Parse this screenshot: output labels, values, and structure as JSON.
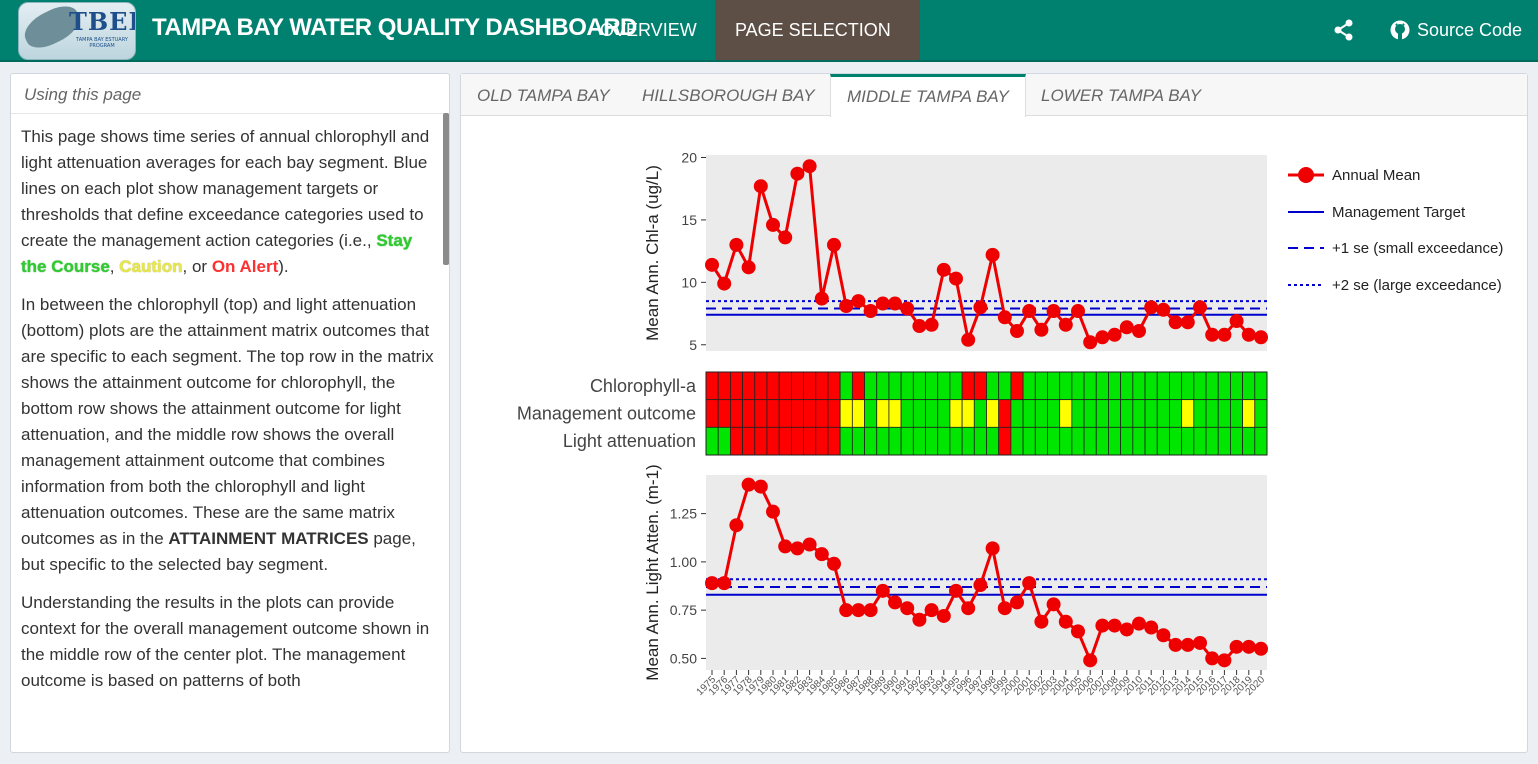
{
  "header": {
    "logo_text": "TBEP",
    "logo_subtext": "TAMPA BAY ESTUARY PROGRAM",
    "title": "TAMPA BAY WATER QUALITY DASHBOARD",
    "nav": {
      "overview": "OVERVIEW",
      "page_selection": "PAGE SELECTION"
    },
    "source_code": "Source Code",
    "accent": "#00806e"
  },
  "sidebar": {
    "heading": "Using this page",
    "p1_before": "This page shows time series of annual chlorophyll and light attenuation averages for each bay segment. Blue lines on each plot show management targets or thresholds that define exceedance categories used to create the management action categories (i.e., ",
    "stay": "Stay the Course",
    "sep1": ", ",
    "caution": "Caution",
    "sep2": ", or ",
    "alert": "On Alert",
    "p1_after": ").",
    "p2_before": "In between the chlorophyll (top) and light attenuation (bottom) plots are the attainment matrix outcomes that are specific to each segment. The top row in the matrix shows the attainment outcome for chlorophyll, the bottom row shows the attainment outcome for light attenuation, and the middle row shows the overall management attainment outcome that combines information from both the chlorophyll and light attenuation outcomes. These are the same matrix outcomes as in the ",
    "p2_bold": "ATTAINMENT MATRICES",
    "p2_after": " page, but specific to the selected bay segment.",
    "p3": "Understanding the results in the plots can provide context for the overall management outcome shown in the middle row of the center plot. The management outcome is based on patterns of both"
  },
  "tabs": [
    "OLD TAMPA BAY",
    "HILLSBOROUGH BAY",
    "MIDDLE TAMPA BAY",
    "LOWER TAMPA BAY"
  ],
  "chart_data": [
    {
      "type": "line",
      "ylabel": "Mean Ann. Chl-a (ug/L)",
      "ylim": [
        4.5,
        20.2
      ],
      "yticks": [
        5,
        10,
        15,
        20
      ],
      "x": [
        1975,
        1976,
        1977,
        1978,
        1979,
        1980,
        1981,
        1982,
        1983,
        1984,
        1985,
        1986,
        1987,
        1988,
        1989,
        1990,
        1991,
        1992,
        1993,
        1994,
        1995,
        1996,
        1997,
        1998,
        1999,
        2000,
        2001,
        2002,
        2003,
        2004,
        2005,
        2006,
        2007,
        2008,
        2009,
        2010,
        2011,
        2012,
        2013,
        2014,
        2015,
        2016,
        2017,
        2018,
        2019,
        2020
      ],
      "series": [
        {
          "name": "Annual Mean",
          "values": [
            11.4,
            9.9,
            13.0,
            11.2,
            17.7,
            14.6,
            13.6,
            18.7,
            19.3,
            8.7,
            13.0,
            8.1,
            8.5,
            7.7,
            8.3,
            8.3,
            7.9,
            6.5,
            6.6,
            11.0,
            10.3,
            5.4,
            8.0,
            12.2,
            7.2,
            6.1,
            7.7,
            6.2,
            7.7,
            6.6,
            7.7,
            5.2,
            5.6,
            5.8,
            6.4,
            6.1,
            8.0,
            7.8,
            6.8,
            6.8,
            8.0,
            5.8,
            5.8,
            6.9,
            5.8,
            5.6
          ]
        },
        {
          "name": "Management Target",
          "values": [
            7.4
          ]
        },
        {
          "name": "+1 se (small exceedance)",
          "values": [
            7.9
          ]
        },
        {
          "name": "+2 se (large exceedance)",
          "values": [
            8.5
          ]
        }
      ],
      "legend_position": "right",
      "grid": false
    },
    {
      "type": "heatmap",
      "rows": [
        "Chlorophyll-a",
        "Management outcome",
        "Light attenuation"
      ],
      "colors": {
        "red": "#ff0000",
        "yellow": "#ffff00",
        "green": "#00e600"
      },
      "cells": [
        "RRRRRRRRRRRGRGGGGGGGGRRGGRGGGGGGGGGGGGGGGGGGGG",
        "RRRRRRRRRRRYYGYYGGGGYYGYRGGGGYGGGGGGGGGYGGGGYG",
        "GGRRRRRRRRRGGGGGGGGGGGGGRGGGGGGGGGGGGGGGGGGGGG"
      ]
    },
    {
      "type": "line",
      "ylabel": "Mean Ann. Light Atten. (m-1)",
      "ylim": [
        0.44,
        1.45
      ],
      "yticks": [
        0.5,
        0.75,
        1.0,
        1.25
      ],
      "ytick_labels": [
        "0.50",
        "0.75",
        "1.00",
        "1.25"
      ],
      "x": [
        1975,
        1976,
        1977,
        1978,
        1979,
        1980,
        1981,
        1982,
        1983,
        1984,
        1985,
        1986,
        1987,
        1988,
        1989,
        1990,
        1991,
        1992,
        1993,
        1994,
        1995,
        1996,
        1997,
        1998,
        1999,
        2000,
        2001,
        2002,
        2003,
        2004,
        2005,
        2006,
        2007,
        2008,
        2009,
        2010,
        2011,
        2012,
        2013,
        2014,
        2015,
        2016,
        2017,
        2018,
        2019,
        2020
      ],
      "series": [
        {
          "name": "Annual Mean",
          "values": [
            0.89,
            0.89,
            1.19,
            1.4,
            1.39,
            1.26,
            1.08,
            1.07,
            1.09,
            1.04,
            0.99,
            0.75,
            0.75,
            0.75,
            0.85,
            0.79,
            0.76,
            0.7,
            0.75,
            0.72,
            0.85,
            0.76,
            0.88,
            1.07,
            0.76,
            0.79,
            0.89,
            0.69,
            0.78,
            0.69,
            0.64,
            0.49,
            0.67,
            0.67,
            0.65,
            0.68,
            0.66,
            0.62,
            0.57,
            0.57,
            0.58,
            0.5,
            0.49,
            0.56,
            0.56,
            0.55
          ]
        },
        {
          "name": "Management Target",
          "values": [
            0.83
          ]
        },
        {
          "name": "+1 se (small exceedance)",
          "values": [
            0.87
          ]
        },
        {
          "name": "+2 se (large exceedance)",
          "values": [
            0.91
          ]
        }
      ],
      "grid": false
    }
  ]
}
